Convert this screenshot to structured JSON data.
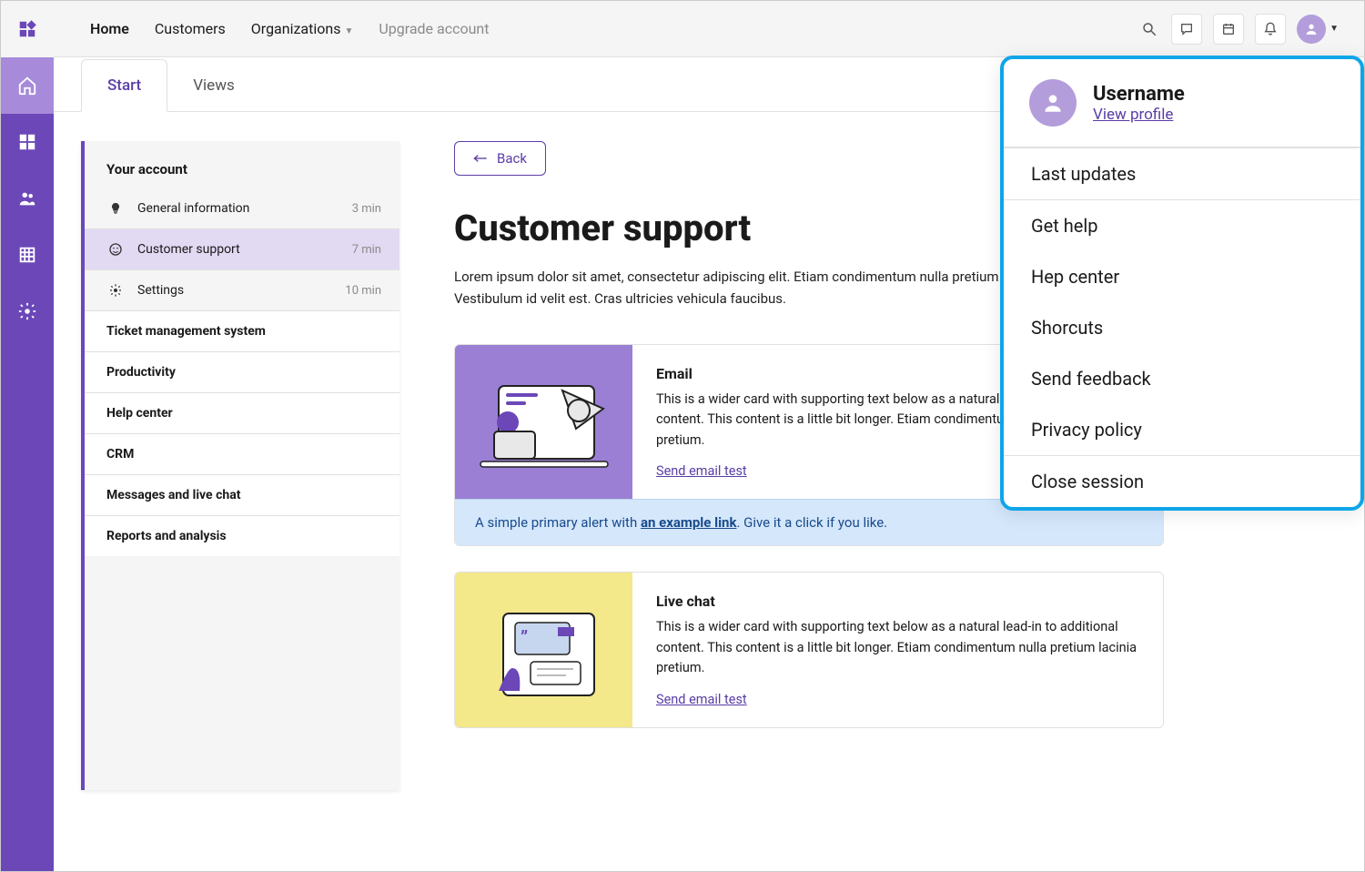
{
  "topnav": {
    "home": "Home",
    "customers": "Customers",
    "organizations": "Organizations",
    "upgrade": "Upgrade account"
  },
  "tabs": {
    "start": "Start",
    "views": "Views"
  },
  "sidebar": {
    "section_account": "Your account",
    "items": [
      {
        "label": "General information",
        "meta": "3 min"
      },
      {
        "label": "Customer support",
        "meta": "7 min"
      },
      {
        "label": "Settings",
        "meta": "10 min"
      }
    ],
    "sections": [
      "Ticket management system",
      "Productivity",
      "Help center",
      "CRM",
      "Messages and live chat",
      "Reports and analysis"
    ]
  },
  "main": {
    "back": "Back",
    "title": "Customer support",
    "lead": "Lorem ipsum dolor sit amet, consectetur adipiscing elit. Etiam condimentum nulla pretium lacinia pretium. Vestibulum id velit est. Cras ultricies vehicula faucibus."
  },
  "cards": [
    {
      "title": "Email",
      "body": "This is a wider card with supporting text below as a natural lead-in to additional content. This content is a little bit longer.  Etiam condimentum nulla pretium lacinia pretium.",
      "link": "Send email test",
      "alert_pre": "A simple primary alert with ",
      "alert_link": "an example link",
      "alert_post": ". Give it a click if you like."
    },
    {
      "title": "Live chat",
      "body": "This is a wider card with supporting text below as a natural lead-in to additional content. This content is a little bit longer.  Etiam condimentum nulla pretium lacinia pretium.",
      "link": "Send email test"
    }
  ],
  "profile": {
    "name": "Username",
    "view": "View profile",
    "items": [
      "Last updates",
      "Get help",
      "Hep center",
      "Shorcuts",
      "Send feedback",
      "Privacy policy"
    ],
    "close": "Close session"
  }
}
